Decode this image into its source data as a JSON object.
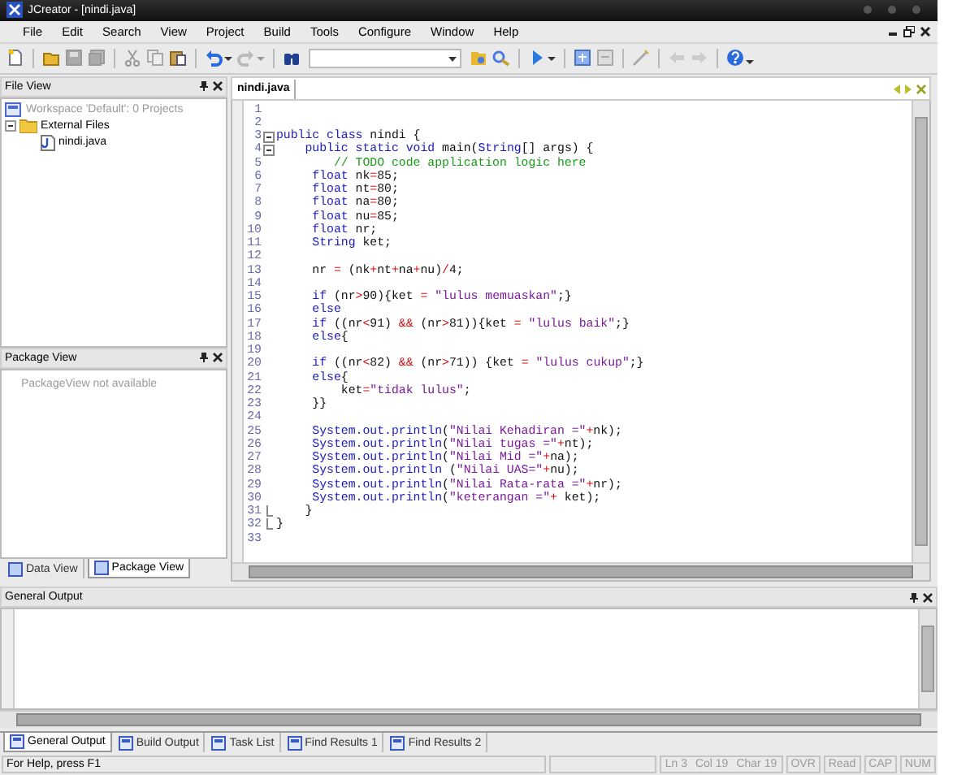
{
  "window": {
    "title": "JCreator - [nindi.java]"
  },
  "menu": [
    "File",
    "Edit",
    "Search",
    "View",
    "Project",
    "Build",
    "Tools",
    "Configure",
    "Window",
    "Help"
  ],
  "file_view": {
    "title": "File View",
    "tree": [
      {
        "label": "Workspace 'Default': 0 Projects",
        "disabled": true
      },
      {
        "label": "External Files",
        "disabled": false,
        "expanded": true,
        "children": [
          {
            "label": "nindi.java",
            "disabled": false
          }
        ]
      }
    ]
  },
  "package_view": {
    "title": "Package View",
    "message": "PackageView not available"
  },
  "left_tabs": [
    {
      "label": "Data View",
      "selected": false
    },
    {
      "label": "Package View",
      "selected": true
    }
  ],
  "editor": {
    "tabs": [
      {
        "label": "nindi.java",
        "selected": true
      }
    ],
    "lines": [
      {
        "number": "1",
        "kind": "plain"
      },
      {
        "number": "2",
        "kind": "plain"
      },
      {
        "number": "3",
        "kind": "fold-start",
        "segments": [
          {
            "kind": "kw",
            "text": "public class"
          },
          {
            "kind": "tx",
            "text": " nindi {"
          }
        ]
      },
      {
        "number": "4",
        "kind": "fold-start",
        "segments": [
          {
            "kind": "kw",
            "text": "    public static void"
          },
          {
            "kind": "tx",
            "text": " main("
          },
          {
            "kind": "kw",
            "text": "String"
          },
          {
            "kind": "tx",
            "text": "[] args) {"
          }
        ]
      },
      {
        "number": "5",
        "kind": "plain",
        "segments": [
          {
            "kind": "com",
            "text": "        // TODO code application logic here"
          }
        ]
      },
      {
        "number": "6",
        "kind": "plain",
        "segments": [
          {
            "kind": "kw",
            "text": "     float"
          },
          {
            "kind": "tx",
            "text": " nk"
          },
          {
            "kind": "op",
            "text": "="
          },
          {
            "kind": "tx",
            "text": "85;"
          }
        ]
      },
      {
        "number": "7",
        "kind": "plain",
        "segments": [
          {
            "kind": "kw",
            "text": "     float"
          },
          {
            "kind": "tx",
            "text": " nt"
          },
          {
            "kind": "op",
            "text": "="
          },
          {
            "kind": "tx",
            "text": "80;"
          }
        ]
      },
      {
        "number": "8",
        "kind": "plain",
        "segments": [
          {
            "kind": "kw",
            "text": "     float"
          },
          {
            "kind": "tx",
            "text": " na"
          },
          {
            "kind": "op",
            "text": "="
          },
          {
            "kind": "tx",
            "text": "80;"
          }
        ]
      },
      {
        "number": "9",
        "kind": "plain",
        "segments": [
          {
            "kind": "kw",
            "text": "     float"
          },
          {
            "kind": "tx",
            "text": " nu"
          },
          {
            "kind": "op",
            "text": "="
          },
          {
            "kind": "tx",
            "text": "85;"
          }
        ]
      },
      {
        "number": "10",
        "kind": "plain",
        "segments": [
          {
            "kind": "kw",
            "text": "     float"
          },
          {
            "kind": "tx",
            "text": " nr;"
          }
        ]
      },
      {
        "number": "11",
        "kind": "plain",
        "segments": [
          {
            "kind": "kw",
            "text": "     String"
          },
          {
            "kind": "tx",
            "text": " ket;"
          }
        ]
      },
      {
        "number": "12",
        "kind": "plain"
      },
      {
        "number": "13",
        "kind": "plain",
        "segments": [
          {
            "kind": "tx",
            "text": "     nr "
          },
          {
            "kind": "op",
            "text": "="
          },
          {
            "kind": "tx",
            "text": " (nk"
          },
          {
            "kind": "op",
            "text": "+"
          },
          {
            "kind": "tx",
            "text": "nt"
          },
          {
            "kind": "op",
            "text": "+"
          },
          {
            "kind": "tx",
            "text": "na"
          },
          {
            "kind": "op",
            "text": "+"
          },
          {
            "kind": "tx",
            "text": "nu)"
          },
          {
            "kind": "op",
            "text": "/"
          },
          {
            "kind": "tx",
            "text": "4;"
          }
        ]
      },
      {
        "number": "14",
        "kind": "plain"
      },
      {
        "number": "15",
        "kind": "plain",
        "segments": [
          {
            "kind": "kw",
            "text": "     if"
          },
          {
            "kind": "tx",
            "text": " (nr"
          },
          {
            "kind": "op",
            "text": ">"
          },
          {
            "kind": "tx",
            "text": "90){ket "
          },
          {
            "kind": "op",
            "text": "="
          },
          {
            "kind": "str",
            "text": " \"lulus memuaskan\""
          },
          {
            "kind": "tx",
            "text": ";}"
          }
        ]
      },
      {
        "number": "16",
        "kind": "plain",
        "segments": [
          {
            "kind": "kw",
            "text": "     else"
          }
        ]
      },
      {
        "number": "17",
        "kind": "plain",
        "segments": [
          {
            "kind": "kw",
            "text": "     if"
          },
          {
            "kind": "tx",
            "text": " ((nr"
          },
          {
            "kind": "op",
            "text": "<"
          },
          {
            "kind": "tx",
            "text": "91) "
          },
          {
            "kind": "op",
            "text": "&&"
          },
          {
            "kind": "tx",
            "text": " (nr"
          },
          {
            "kind": "op",
            "text": ">"
          },
          {
            "kind": "tx",
            "text": "81)){ket "
          },
          {
            "kind": "op",
            "text": "="
          },
          {
            "kind": "str",
            "text": " \"lulus baik\""
          },
          {
            "kind": "tx",
            "text": ";}"
          }
        ]
      },
      {
        "number": "18",
        "kind": "plain",
        "segments": [
          {
            "kind": "kw",
            "text": "     else"
          },
          {
            "kind": "tx",
            "text": "{"
          }
        ]
      },
      {
        "number": "19",
        "kind": "plain"
      },
      {
        "number": "20",
        "kind": "plain",
        "segments": [
          {
            "kind": "kw",
            "text": "     if"
          },
          {
            "kind": "tx",
            "text": " ((nr"
          },
          {
            "kind": "op",
            "text": "<"
          },
          {
            "kind": "tx",
            "text": "82) "
          },
          {
            "kind": "op",
            "text": "&&"
          },
          {
            "kind": "tx",
            "text": " (nr"
          },
          {
            "kind": "op",
            "text": ">"
          },
          {
            "kind": "tx",
            "text": "71)) {ket "
          },
          {
            "kind": "op",
            "text": "="
          },
          {
            "kind": "str",
            "text": " \"lulus cukup\""
          },
          {
            "kind": "tx",
            "text": ";}"
          }
        ]
      },
      {
        "number": "21",
        "kind": "plain",
        "segments": [
          {
            "kind": "kw",
            "text": "     else"
          },
          {
            "kind": "tx",
            "text": "{"
          }
        ]
      },
      {
        "number": "22",
        "kind": "plain",
        "segments": [
          {
            "kind": "tx",
            "text": "         ket"
          },
          {
            "kind": "op",
            "text": "="
          },
          {
            "kind": "str",
            "text": "\"tidak lulus\""
          },
          {
            "kind": "tx",
            "text": ";"
          }
        ]
      },
      {
        "number": "23",
        "kind": "plain",
        "segments": [
          {
            "kind": "tx",
            "text": "     }}"
          }
        ]
      },
      {
        "number": "24",
        "kind": "plain"
      },
      {
        "number": "25",
        "kind": "plain",
        "segments": [
          {
            "kind": "kw",
            "text": "     System.out.println"
          },
          {
            "kind": "tx",
            "text": "("
          },
          {
            "kind": "str",
            "text": "\"Nilai Kehadiran =\""
          },
          {
            "kind": "op",
            "text": "+"
          },
          {
            "kind": "tx",
            "text": "nk);"
          }
        ]
      },
      {
        "number": "26",
        "kind": "plain",
        "segments": [
          {
            "kind": "kw",
            "text": "     System.out.println"
          },
          {
            "kind": "tx",
            "text": "("
          },
          {
            "kind": "str",
            "text": "\"Nilai tugas =\""
          },
          {
            "kind": "op",
            "text": "+"
          },
          {
            "kind": "tx",
            "text": "nt);"
          }
        ]
      },
      {
        "number": "27",
        "kind": "plain",
        "segments": [
          {
            "kind": "kw",
            "text": "     System.out.println"
          },
          {
            "kind": "tx",
            "text": "("
          },
          {
            "kind": "str",
            "text": "\"Nilai Mid =\""
          },
          {
            "kind": "op",
            "text": "+"
          },
          {
            "kind": "tx",
            "text": "na);"
          }
        ]
      },
      {
        "number": "28",
        "kind": "plain",
        "segments": [
          {
            "kind": "kw",
            "text": "     System.out.println"
          },
          {
            "kind": "tx",
            "text": " ("
          },
          {
            "kind": "str",
            "text": "\"Nilai UAS=\""
          },
          {
            "kind": "op",
            "text": "+"
          },
          {
            "kind": "tx",
            "text": "nu);"
          }
        ]
      },
      {
        "number": "29",
        "kind": "plain",
        "segments": [
          {
            "kind": "kw",
            "text": "     System.out.println"
          },
          {
            "kind": "tx",
            "text": "("
          },
          {
            "kind": "str",
            "text": "\"Nilai Rata-rata =\""
          },
          {
            "kind": "op",
            "text": "+"
          },
          {
            "kind": "tx",
            "text": "nr);"
          }
        ]
      },
      {
        "number": "30",
        "kind": "plain",
        "segments": [
          {
            "kind": "kw",
            "text": "     System.out.println"
          },
          {
            "kind": "tx",
            "text": "("
          },
          {
            "kind": "str",
            "text": "\"keterangan =\""
          },
          {
            "kind": "op",
            "text": "+"
          },
          {
            "kind": "tx",
            "text": " ket);"
          }
        ]
      },
      {
        "number": "31",
        "kind": "fold-end",
        "segments": [
          {
            "kind": "tx",
            "text": "    }"
          }
        ]
      },
      {
        "number": "32",
        "kind": "fold-end",
        "segments": [
          {
            "kind": "tx",
            "text": "}"
          }
        ]
      },
      {
        "number": "33",
        "kind": "plain"
      }
    ]
  },
  "output": {
    "title": "General Output"
  },
  "output_tabs": [
    {
      "label": "General Output",
      "selected": true
    },
    {
      "label": "Build Output",
      "selected": false
    },
    {
      "label": "Task List",
      "selected": false
    },
    {
      "label": "Find Results 1",
      "selected": false
    },
    {
      "label": "Find Results 2",
      "selected": false
    }
  ],
  "status_bar": {
    "message": "For Help, press F1",
    "position": [
      "Ln 3",
      "Col 19",
      "Char 19"
    ],
    "indicators": [
      "OVR",
      "Read",
      "CAP",
      "NUM"
    ]
  }
}
